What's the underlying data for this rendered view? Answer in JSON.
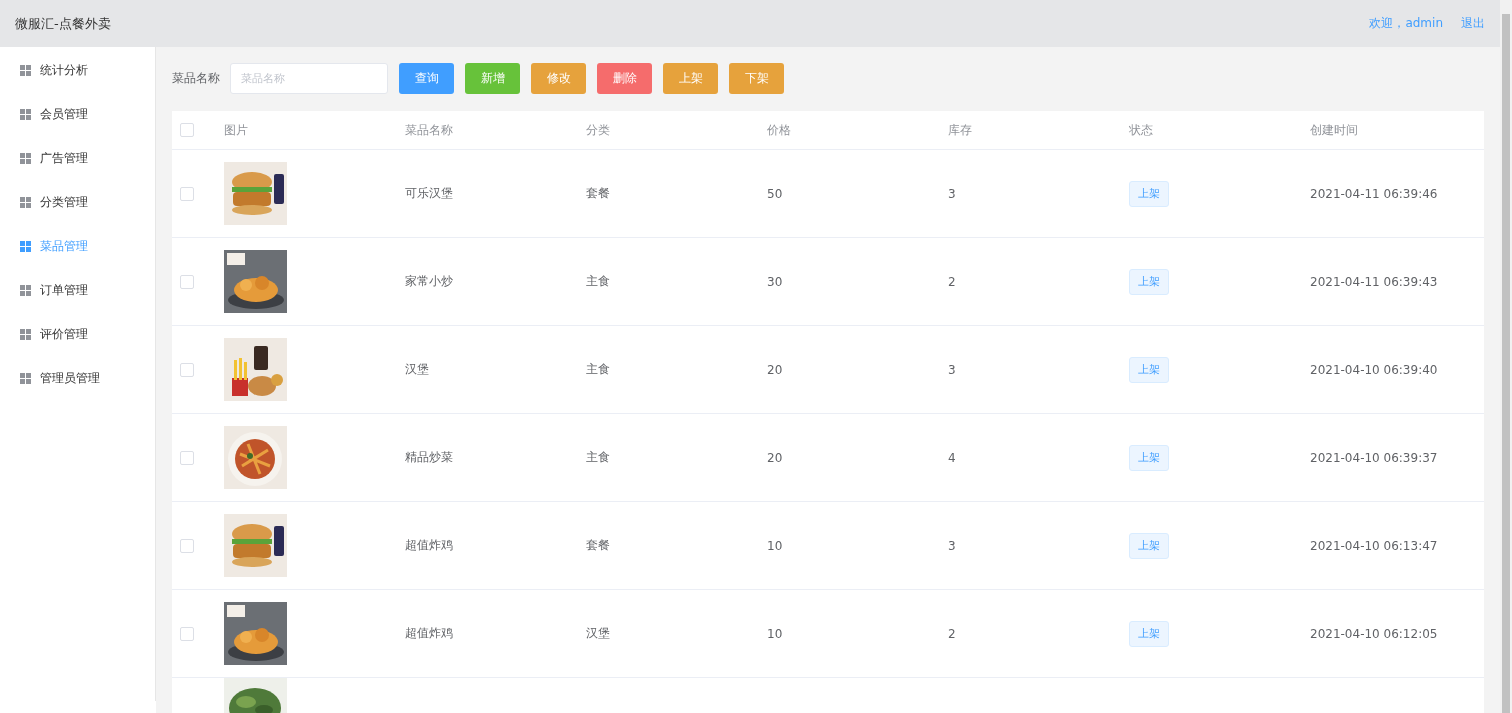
{
  "header": {
    "title": "微服汇-点餐外卖",
    "welcome": "欢迎，admin",
    "logout": "退出"
  },
  "sidebar": {
    "items": [
      {
        "label": "统计分析",
        "selected": false
      },
      {
        "label": "会员管理",
        "selected": false
      },
      {
        "label": "广告管理",
        "selected": false
      },
      {
        "label": "分类管理",
        "selected": false
      },
      {
        "label": "菜品管理",
        "selected": true
      },
      {
        "label": "订单管理",
        "selected": false
      },
      {
        "label": "评价管理",
        "selected": false
      },
      {
        "label": "管理员管理",
        "selected": false
      }
    ]
  },
  "toolbar": {
    "label": "菜品名称",
    "search": {
      "placeholder": "菜品名称"
    },
    "buttons": [
      {
        "label": "查询",
        "kind": "primary"
      },
      {
        "label": "新增",
        "kind": "success"
      },
      {
        "label": "修改",
        "kind": "warning"
      },
      {
        "label": "删除",
        "kind": "danger"
      },
      {
        "label": "上架",
        "kind": "warning"
      },
      {
        "label": "下架",
        "kind": "warning"
      }
    ]
  },
  "table": {
    "select_all": {
      "checked": false
    },
    "columns": [
      "图片",
      "菜品名称",
      "分类",
      "价格",
      "库存",
      "状态",
      "创建时间"
    ],
    "rows": [
      {
        "checked": false,
        "image": {
          "kind": "picture"
        },
        "name": "可乐汉堡",
        "category": "套餐",
        "price": "50",
        "stock": "3",
        "status": "上架",
        "created": "2021-04-11 06:39:46"
      },
      {
        "checked": false,
        "image": {
          "kind": "picture"
        },
        "name": "家常小炒",
        "category": "主食",
        "price": "30",
        "stock": "2",
        "status": "上架",
        "created": "2021-04-11 06:39:43"
      },
      {
        "checked": false,
        "image": {
          "kind": "picture"
        },
        "name": "汉堡",
        "category": "主食",
        "price": "20",
        "stock": "3",
        "status": "上架",
        "created": "2021-04-10 06:39:40"
      },
      {
        "checked": false,
        "image": {
          "kind": "picture"
        },
        "name": "精品炒菜",
        "category": "主食",
        "price": "20",
        "stock": "4",
        "status": "上架",
        "created": "2021-04-10 06:39:37"
      },
      {
        "checked": false,
        "image": {
          "kind": "picture"
        },
        "name": "超值炸鸡",
        "category": "套餐",
        "price": "10",
        "stock": "3",
        "status": "上架",
        "created": "2021-04-10 06:13:47"
      },
      {
        "checked": false,
        "image": {
          "kind": "picture"
        },
        "name": "超值炸鸡",
        "category": "汉堡",
        "price": "10",
        "stock": "2",
        "status": "上架",
        "created": "2021-04-10 06:12:05"
      }
    ],
    "partial_row": {
      "image": {
        "kind": "picture"
      }
    }
  }
}
